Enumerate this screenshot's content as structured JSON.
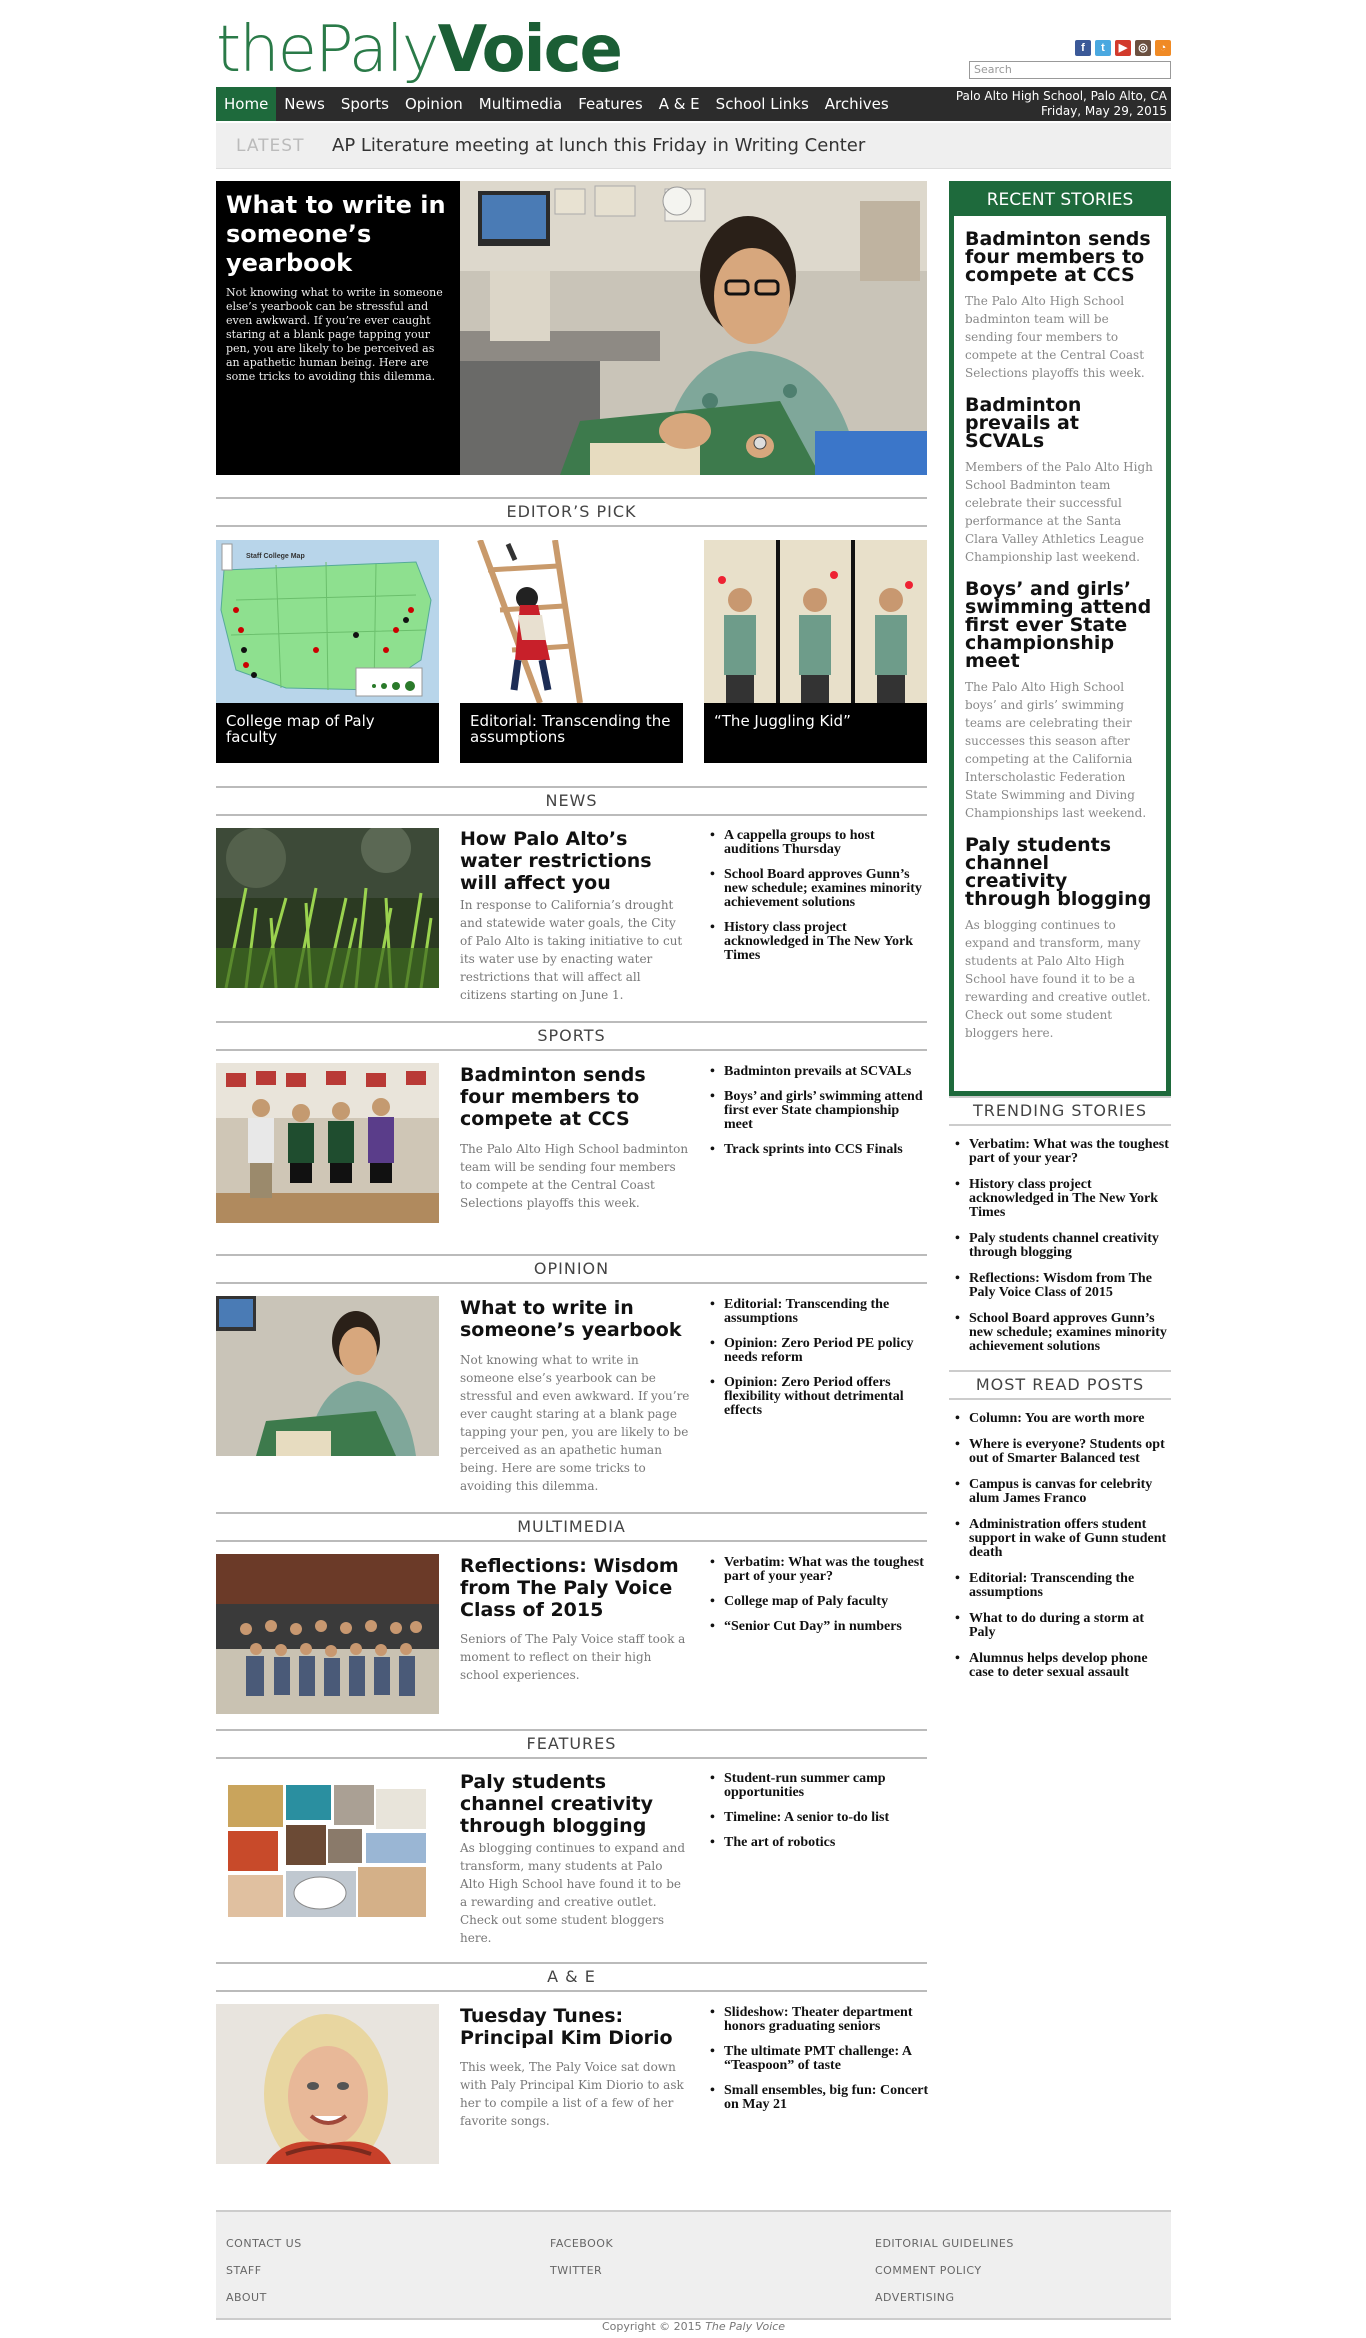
{
  "brand": {
    "logo_thin": "thePaly",
    "logo_bold": "Voice",
    "accent": "#1e6a3c"
  },
  "social": [
    "facebook-icon",
    "twitter-icon",
    "youtube-icon",
    "instagram-icon",
    "rss-icon"
  ],
  "search": {
    "placeholder": "Search"
  },
  "nav": {
    "items": [
      "Home",
      "News",
      "Sports",
      "Opinion",
      "Multimedia",
      "Features",
      "A & E",
      "School Links",
      "Archives"
    ],
    "location": "Palo Alto High School, Palo Alto, CA",
    "date": "Friday, May 29, 2015"
  },
  "latest": {
    "tag": "LATEST",
    "text": "AP Literature meeting at lunch this Friday in Writing Center"
  },
  "hero": {
    "title": "What to write in someone’s yearbook",
    "summary": "Not knowing what to write in someone else’s yearbook can be stressful and even awkward. If you’re ever caught staring at a blank page tapping your pen, you are likely to be perceived as an apathetic human being. Here are some tricks to avoiding this dilemma."
  },
  "editors_pick": {
    "heading": "EDITOR’S PICK",
    "items": [
      {
        "caption": "College map of Paly faculty",
        "map_title": "Staff College Map"
      },
      {
        "caption": "Editorial: Transcending the assumptions"
      },
      {
        "caption": "“The Juggling Kid”"
      }
    ]
  },
  "sections": [
    {
      "heading": "NEWS",
      "title": "How Palo Alto’s water restrictions will affect you",
      "text": "In response to California’s drought and statewide water goals, the City of Palo Alto is taking initiative to cut its water use by enacting water restrictions that will affect all citizens starting on June 1.",
      "links": [
        "A cappella groups to host auditions Thursday",
        "School Board approves Gunn’s new schedule; examines minority achievement solutions",
        "History class project acknowledged in The New York Times"
      ]
    },
    {
      "heading": "SPORTS",
      "title": "Badminton sends four members to compete at CCS",
      "text": "The Palo Alto High School badminton team will be sending four members to compete at the Central Coast Selections playoffs this week.",
      "links": [
        "Badminton prevails at SCVALs",
        "Boys’ and girls’ swimming attend first ever State championship meet",
        "Track sprints into CCS Finals"
      ]
    },
    {
      "heading": "OPINION",
      "title": "What to write in someone’s yearbook",
      "text": "Not knowing what to write in someone else’s yearbook can be stressful and even awkward. If you’re ever caught staring at a blank page tapping your pen, you are likely to be perceived as an apathetic human being. Here are some tricks to avoiding this dilemma.",
      "links": [
        "Editorial: Transcending the assumptions",
        "Opinion: Zero Period PE policy needs reform",
        "Opinion: Zero Period offers flexibility without detrimental effects"
      ]
    },
    {
      "heading": "MULTIMEDIA",
      "title": "Reflections: Wisdom from The Paly Voice Class of 2015",
      "text": "Seniors of The Paly Voice staff took a moment to reflect on their high school experiences.",
      "links": [
        "Verbatim: What was the toughest part of your year?",
        "College map of Paly faculty",
        "“Senior Cut Day” in numbers"
      ]
    },
    {
      "heading": "FEATURES",
      "title": "Paly students channel creativity through blogging",
      "text": "As blogging continues to expand and transform, many students at Palo Alto High School have found it to be a rewarding and creative outlet. Check out some student bloggers here.",
      "links": [
        "Student-run summer camp opportunities",
        "Timeline: A senior to-do list",
        "The art of robotics"
      ]
    },
    {
      "heading": "A & E",
      "title": "Tuesday Tunes: Principal Kim Diorio",
      "text": "This week, The Paly Voice sat down with Paly Principal Kim Diorio to ask her to compile a list of a few of her favorite songs.",
      "links": [
        "Slideshow: Theater department honors graduating seniors",
        "The ultimate PMT challenge: A “Teaspoon” of taste",
        "Small ensembles, big fun: Concert on May 21"
      ]
    }
  ],
  "recent": {
    "heading": "RECENT STORIES",
    "stories": [
      {
        "title": "Badminton sends four members to compete at CCS",
        "text": "The Palo Alto High School badminton team will be sending four members to compete at the Central Coast Selections playoffs this week."
      },
      {
        "title": "Badminton prevails at SCVALs",
        "text": "Members of the Palo Alto High School Badminton team celebrate their successful performance at the Santa Clara Valley Athletics League Championship last weekend."
      },
      {
        "title": "Boys’ and girls’ swimming attend first ever State championship meet",
        "text": "The Palo Alto High School boys’ and girls’ swimming teams are celebrating their successes this season after competing at the California Interscholastic Federation State Swimming and Diving Championships last weekend."
      },
      {
        "title": "Paly students channel creativity through blogging",
        "text": "As blogging continues to expand and transform, many students at Palo Alto High School have found it to be a rewarding and creative outlet. Check out some student bloggers here."
      }
    ]
  },
  "trending": {
    "heading": "TRENDING STORIES",
    "items": [
      "Verbatim: What was the toughest part of your year?",
      "History class project acknowledged in The New York Times",
      "Paly students channel creativity through blogging",
      "Reflections: Wisdom from The Paly Voice Class of 2015",
      "School Board approves Gunn’s new schedule; examines minority achievement solutions"
    ]
  },
  "most_read": {
    "heading": "MOST READ POSTS",
    "items": [
      "Column: You are worth more",
      "Where is everyone? Students opt out of Smarter Balanced test",
      "Campus is canvas for celebrity alum James Franco",
      "Administration offers student support in wake of Gunn student death",
      "Editorial: Transcending the assumptions",
      "What to do during a storm at Paly",
      "Alumnus helps develop phone case to deter sexual assault"
    ]
  },
  "footer": {
    "col1": [
      "CONTACT US",
      "STAFF",
      "ABOUT"
    ],
    "col2": [
      "FACEBOOK",
      "TWITTER"
    ],
    "col3": [
      "EDITORIAL GUIDELINES",
      "COMMENT POLICY",
      "ADVERTISING"
    ],
    "copyright_prefix": "Copyright © 2015",
    "copyright_name": "The Paly Voice"
  }
}
